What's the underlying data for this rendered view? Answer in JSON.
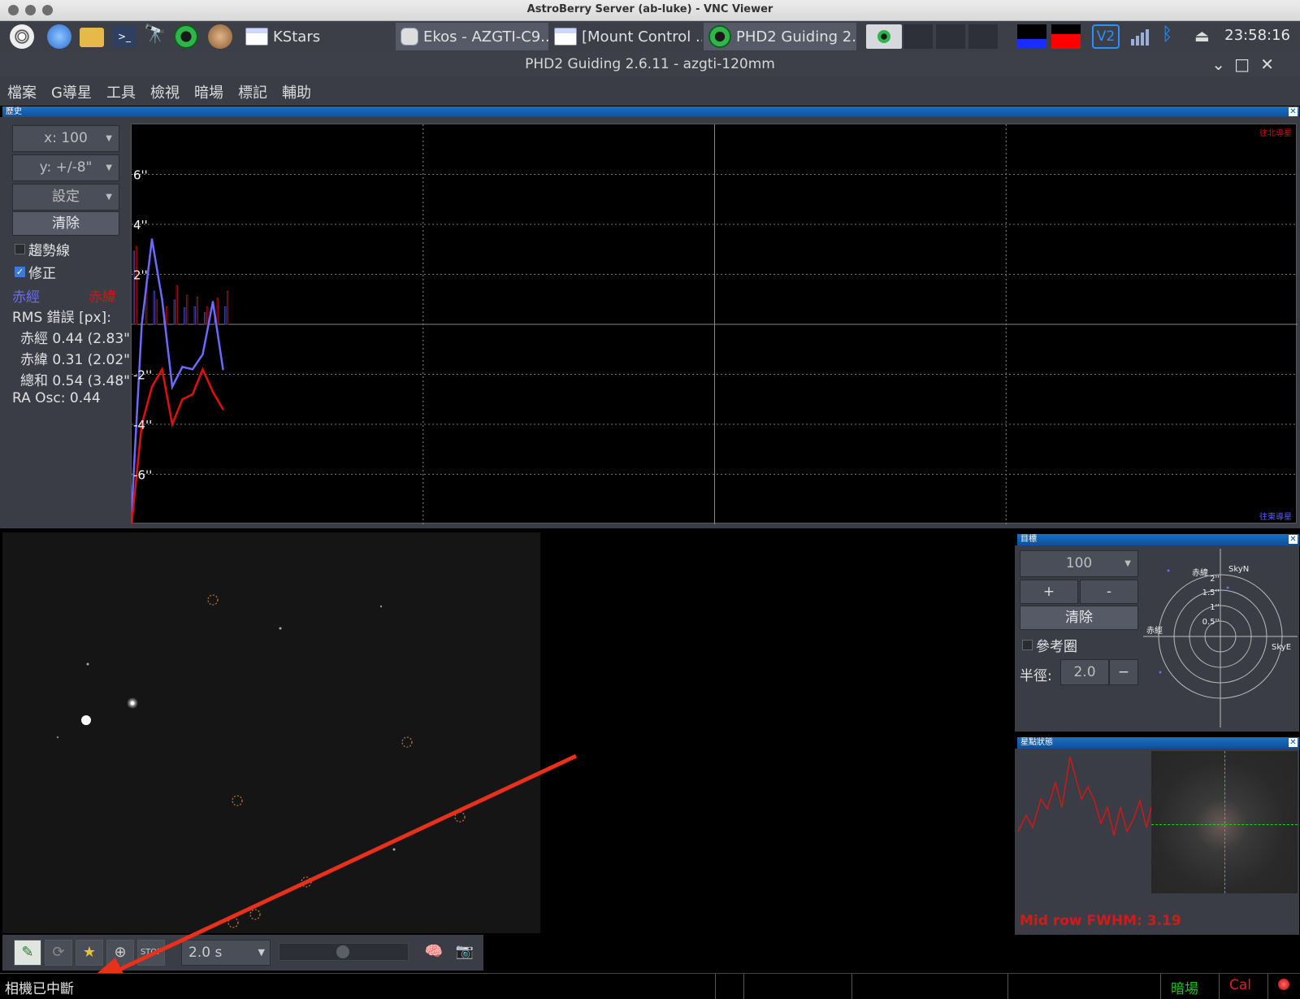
{
  "window": {
    "mac_title": "AstroBerry Server (ab-luke) - VNC Viewer",
    "app_title": "PHD2 Guiding 2.6.11 - azgti-120mm"
  },
  "taskbar": {
    "tasks": [
      {
        "label": "KStars"
      },
      {
        "label": "Ekos - AZGTI-C9..."
      },
      {
        "label": "[Mount Control ..."
      },
      {
        "label": "PHD2 Guiding 2...."
      }
    ],
    "clock": "23:58:16"
  },
  "menu": {
    "items": [
      "檔案",
      "G導星",
      "工具",
      "檢視",
      "暗場",
      "標記",
      "輔助"
    ]
  },
  "history": {
    "pane_title": "歷史",
    "x_scale": "x: 100",
    "y_scale": "y: +/-8\"",
    "settings": "設定",
    "clear": "清除",
    "trend_label": "趨勢線",
    "correction_label": "修正",
    "ra_label": "赤經",
    "dec_label": "赤緯",
    "rms_label": "RMS 錯誤 [px]:",
    "rms_ra": "赤經 0.44 (2.83\")",
    "rms_dec": "赤緯 0.31 (2.02\")",
    "rms_total": "總和 0.54 (3.48\")",
    "ra_osc": "RA Osc: 0.44",
    "north_label": "往北導星",
    "east_label": "往東導星",
    "y_ticks": [
      "6''",
      "4''",
      "2''",
      "-2''",
      "-4''",
      "-6''"
    ]
  },
  "chart_data": {
    "type": "line",
    "ylim": [
      -8,
      8
    ],
    "series": [
      {
        "name": "赤經",
        "color": "#6a6aff",
        "values": [
          -7.5,
          0,
          3.4,
          1,
          -2.5,
          -1.7,
          -1.8,
          -1.2,
          0.9,
          -1.8
        ]
      },
      {
        "name": "赤緯",
        "color": "#e01010",
        "values": [
          -8,
          -4,
          -2.5,
          -1.8,
          -4,
          -3,
          -2.8,
          -1.8,
          -2.7,
          -3.4
        ]
      }
    ]
  },
  "target": {
    "pane_title": "目標",
    "scale": "100",
    "plus": "+",
    "minus": "-",
    "clear": "清除",
    "ref_circle": "參考圈",
    "radius_label": "半徑:",
    "radius_value": "2.0",
    "radius_minus": "−",
    "dec_axis": "赤緯",
    "ra_axis": "赤經",
    "sky_n": "SkyN",
    "sky_e": "SkyE",
    "rings": [
      "2''",
      "1.5''",
      "1''",
      "0.5''"
    ]
  },
  "star_profile": {
    "pane_title": "星點狀態",
    "fwhm": "Mid row FWHM: 3.19"
  },
  "toolbar": {
    "exposure": "2.0 s"
  },
  "status": {
    "message": "相機已中斷",
    "dark": "暗場",
    "cal": "Cal"
  },
  "colors": {
    "ra": "#6a6aff",
    "dec": "#e01010",
    "accent_blue": "#1c6fc4",
    "dark_ok": "#22c022",
    "cal": "#e02020",
    "annotation_arrow": "#e8301a"
  }
}
